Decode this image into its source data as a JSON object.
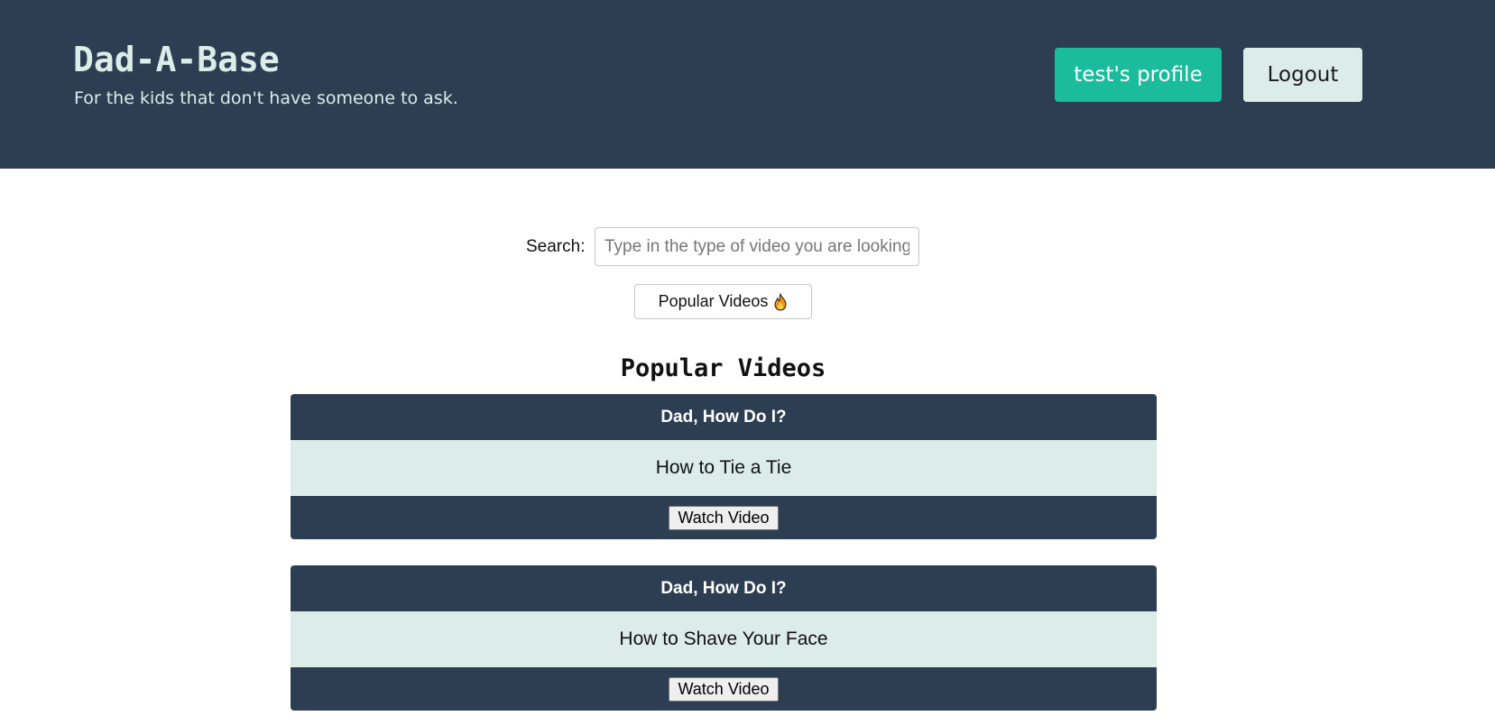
{
  "header": {
    "title": "Dad-A-Base",
    "tagline": "For the kids that don't have someone to ask.",
    "profile_button": "test's profile",
    "logout_button": "Logout"
  },
  "search": {
    "label": "Search:",
    "placeholder": "Type in the type of video you are looking for",
    "value": ""
  },
  "popular_button": {
    "label": "Popular Videos",
    "icon": "flame-icon"
  },
  "section": {
    "title": "Popular Videos"
  },
  "videos": [
    {
      "category": "Dad, How Do I?",
      "title": "How to Tie a Tie",
      "button": "Watch Video"
    },
    {
      "category": "Dad, How Do I?",
      "title": "How to Shave Your Face",
      "button": "Watch Video"
    }
  ],
  "colors": {
    "header_bg": "#2d3e52",
    "accent": "#1abc9c",
    "light": "#dcece8"
  }
}
